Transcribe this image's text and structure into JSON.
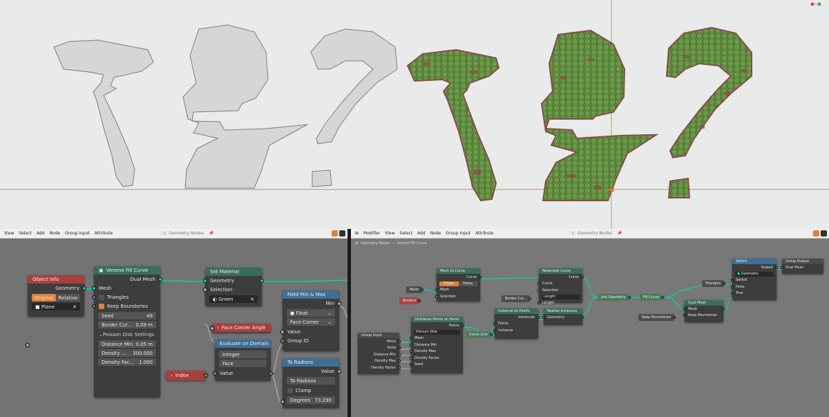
{
  "colors": {
    "viewport_bg": "#e9eaea",
    "shape_grey": "#d6d6d6",
    "shape_green": "#5e8a3d",
    "shape_border": "#8a4a4a",
    "geometry_header": "#3a6e5b",
    "input_header": "#a83f3f",
    "converter_header": "#3f6f95",
    "socket_geometry": "#00d6a3"
  },
  "left_header": {
    "menus": [
      "View",
      "Select",
      "Add",
      "Node",
      "Group Input",
      "Attribute"
    ],
    "tree_label": "Geometry Nodes"
  },
  "right_header": {
    "mode": "Modifier",
    "menus": [
      "View",
      "Select",
      "Add",
      "Node",
      "Group Input",
      "Attribute"
    ],
    "tree_label": "Geometry Nodes"
  },
  "breadcrumb": {
    "root": "Geometry Nodes",
    "current": "Voronoi Fill Curve"
  },
  "left": {
    "object_info": {
      "title": "Object Info",
      "out_geometry": "Geometry",
      "mode_original": "Original",
      "mode_relative": "Relative",
      "object": "Plane"
    },
    "voronoi": {
      "title": "Voronoi Fill Curve",
      "out": "Dual Mesh",
      "in_mesh": "Mesh",
      "triangles": "Triangles",
      "keep_boundaries": "Keep Boundaries",
      "seed_label": "Seed",
      "seed_value": "49",
      "border_label": "Border Cur...",
      "border_value": "0.09 m",
      "panel": "Poisson Disk Settings",
      "dist_label": "Distance Min",
      "dist_value": "0.05 m",
      "density_label": "Density ...",
      "density_value": "300.000",
      "factor_label": "Density Fac...",
      "factor_value": "1.000"
    },
    "set_material": {
      "title": "Set Material",
      "geometry": "Geometry",
      "selection": "Selection",
      "material": "Green"
    },
    "field_minmax": {
      "title": "Field Min & Max",
      "out_min": "Min",
      "type": "Float",
      "domain": "Face Corner",
      "value": "Value",
      "group_id": "Group ID"
    },
    "face_corner_angle": {
      "title": "Face Corner Angle"
    },
    "evaluate": {
      "title": "Evaluate on Domain",
      "type": "Integer",
      "domain": "Face",
      "value": "Value"
    },
    "to_radians": {
      "title": "To Radians",
      "out": "Value",
      "op": "To Radians",
      "clamp": "Clamp",
      "deg_label": "Degrees",
      "deg_value": "73.290"
    },
    "index": {
      "title": "Index"
    }
  },
  "right": {
    "mesh_pill": "Mesh",
    "borders_pill": "Borders",
    "mesh_to_curve": {
      "title": "Mesh to Curve",
      "out": "Curve",
      "edges": "Edges",
      "faces": "Faces",
      "mesh": "Mesh",
      "selection": "Selection"
    },
    "resample": {
      "title": "Resample Curve",
      "out": "Curve",
      "curve": "Curve",
      "selection": "Selection",
      "mode": "Length",
      "length": "Length"
    },
    "border_pill": "Border Cur...",
    "join": "Join Geometry",
    "fill": "Fill Curve",
    "triangles_pill": "Triangles",
    "switch": {
      "title": "Switch",
      "out": "Output",
      "type": "Geometry",
      "switch": "Switch",
      "false": "False",
      "true": "True"
    },
    "group_output": {
      "title": "Group Output",
      "dual": "Dual Mesh"
    },
    "dual_mesh": {
      "title": "Dual Mesh",
      "mesh": "Mesh",
      "keep": "Keep Boundaries"
    },
    "keep_pill": "Keep Boundaries",
    "instance": {
      "title": "Instance on Points",
      "out": "Instances",
      "points": "Points",
      "instance": "Instance"
    },
    "realize": {
      "title": "Realize Instances",
      "out": "Geometry",
      "geometry": "Geometry"
    },
    "curve_line": "Curve Line",
    "distribute": {
      "title": "Distribute Points on Faces",
      "out": "Points",
      "mode": "Poisson Disk",
      "mesh": "Mesh",
      "dist": "Distance Min",
      "dmax": "Density Max",
      "dfac": "Density Factor",
      "seed": "Seed"
    },
    "group_input": {
      "title": "Group Input",
      "mesh": "Mesh",
      "seed": "Seed",
      "dist": "Distance Min",
      "dmax": "Density Max",
      "dfac": "Density Factor"
    }
  }
}
